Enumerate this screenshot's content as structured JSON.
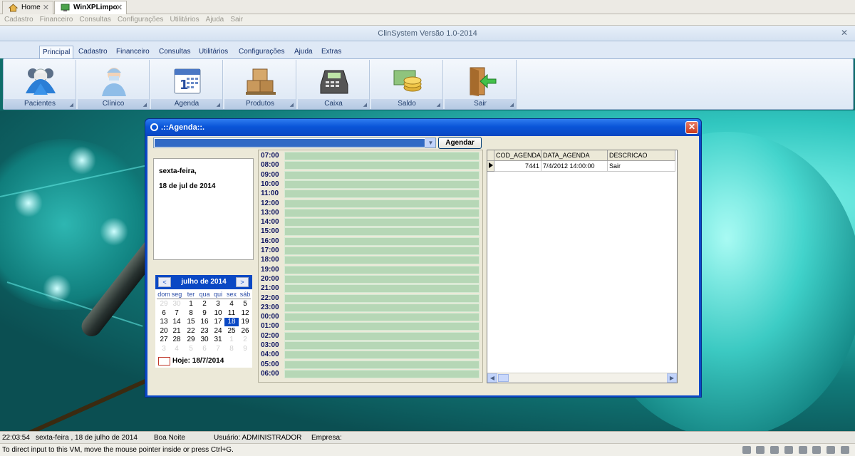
{
  "vm_tabs": [
    {
      "label": "Home"
    },
    {
      "label": "WinXPLimpo"
    }
  ],
  "guest_menu": [
    "Cadastro",
    "Financeiro",
    "Consultas",
    "Configurações",
    "Utilitários",
    "Ajuda",
    "Sair"
  ],
  "app_title": "ClinSystem Versão 1.0-2014",
  "ribbon": {
    "tabs": [
      "Principal",
      "Cadastro",
      "Financeiro",
      "Consultas",
      "Utilitários",
      "Configurações",
      "Ajuda",
      "Extras"
    ],
    "active_tab": "Principal",
    "groups": [
      {
        "label": "Pacientes",
        "icon": "patients-icon"
      },
      {
        "label": "Clínico",
        "icon": "doctor-icon"
      },
      {
        "label": "Agenda",
        "icon": "calendar-icon"
      },
      {
        "label": "Produtos",
        "icon": "boxes-icon"
      },
      {
        "label": "Caixa",
        "icon": "cash-register-icon"
      },
      {
        "label": "Saldo",
        "icon": "money-icon"
      },
      {
        "label": "Sair",
        "icon": "exit-door-icon"
      }
    ]
  },
  "dialog": {
    "title": ".::Agenda::.",
    "agendar_button": "Agendar",
    "date_weekday": "sexta-feira,",
    "date_full": "18 de jul de 2014",
    "calendar": {
      "month_label": "julho de 2014",
      "prev": "<",
      "next": ">",
      "weekdays": [
        "dom",
        "seg",
        "ter",
        "qua",
        "qui",
        "sex",
        "sáb"
      ],
      "weeks": [
        [
          "29",
          "30",
          "1",
          "2",
          "3",
          "4",
          "5"
        ],
        [
          "6",
          "7",
          "8",
          "9",
          "10",
          "11",
          "12"
        ],
        [
          "13",
          "14",
          "15",
          "16",
          "17",
          "18",
          "19"
        ],
        [
          "20",
          "21",
          "22",
          "23",
          "24",
          "25",
          "26"
        ],
        [
          "27",
          "28",
          "29",
          "30",
          "31",
          "1",
          "2"
        ],
        [
          "3",
          "4",
          "5",
          "6",
          "7",
          "8",
          "9"
        ]
      ],
      "selected_day": "18",
      "today_label": "Hoje: 18/7/2014"
    },
    "hours": [
      "07:00",
      "08:00",
      "09:00",
      "10:00",
      "11:00",
      "12:00",
      "13:00",
      "14:00",
      "15:00",
      "16:00",
      "17:00",
      "18:00",
      "19:00",
      "20:00",
      "21:00",
      "22:00",
      "23:00",
      "00:00",
      "01:00",
      "02:00",
      "03:00",
      "04:00",
      "05:00",
      "06:00"
    ],
    "grid": {
      "columns": [
        "COD_AGENDA",
        "DATA_AGENDA",
        "DESCRICAO"
      ],
      "rows": [
        [
          "7441",
          "7/4/2012 14:00:00",
          "Sair"
        ]
      ]
    }
  },
  "app_status": {
    "time": "22:03:54",
    "date": "sexta-feira , 18  de  julho  de  2014",
    "greeting": "Boa Noite",
    "user": "Usuário: ADMINISTRADOR",
    "company": "Empresa:"
  },
  "vm_status_message": "To direct input to this VM, move the mouse pointer inside or press Ctrl+G.",
  "colors": {
    "dialog_frame": "#0a49c8",
    "slot_fill": "#b6d7b6",
    "calendar_header": "#0a48c4",
    "ribbon_bg": "#dfe9f6"
  }
}
